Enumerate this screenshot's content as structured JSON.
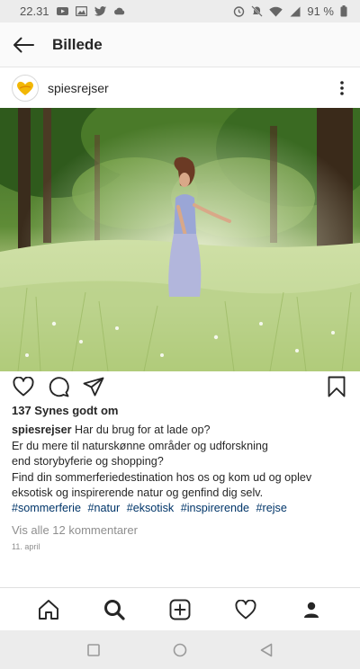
{
  "status_bar": {
    "time": "22.31",
    "battery": "91 %",
    "icons": [
      "youtube-icon",
      "photo-icon",
      "twitter-icon",
      "cloud-icon",
      "alarm-icon",
      "mute-icon",
      "wifi-icon",
      "signal-icon",
      "battery-icon"
    ]
  },
  "header": {
    "title": "Billede",
    "back_icon": "back-arrow-icon"
  },
  "post": {
    "username": "spiesrejser",
    "likes": "137 Synes godt om",
    "caption_lines": [
      "Har du brug for at lade op?",
      "Er du mere til naturskønne områder og udforskning",
      "end storybyferie og shopping?",
      "Find din sommerferiedestination hos os og kom ud og oplev",
      "eksotisk og inspirerende natur og genfind dig selv."
    ],
    "hashtags": [
      "#sommerferie",
      "#natur",
      "#eksotisk",
      "#inspirerende",
      "#rejse"
    ],
    "view_comments": "Vis alle 12 kommentarer",
    "date": "11. april"
  },
  "bottom_nav": [
    "home-icon",
    "search-icon",
    "add-post-icon",
    "activity-heart-icon",
    "profile-icon"
  ],
  "colors": {
    "hashtag": "#003569",
    "muted": "#8e8e8e",
    "text": "#262626",
    "status_bg": "#ececec"
  }
}
